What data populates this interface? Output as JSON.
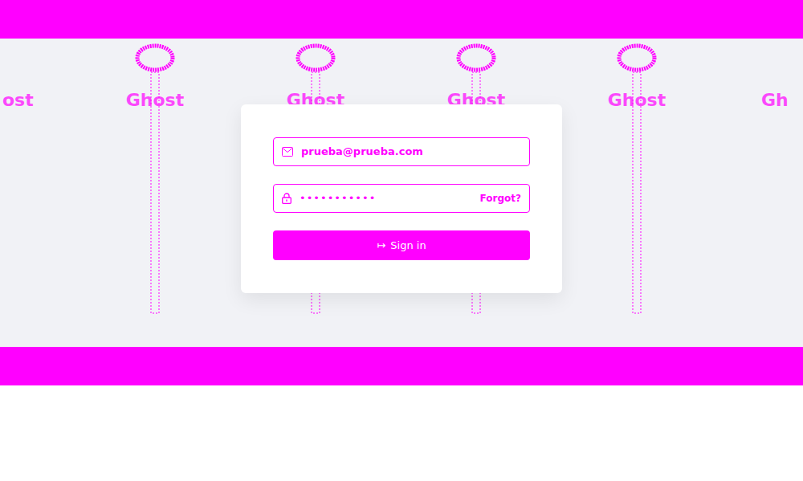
{
  "background": {
    "watermarks": [
      "ost",
      "Ghost",
      "Ghost",
      "Ghost",
      "Ghost",
      "Gh"
    ]
  },
  "login": {
    "email": {
      "value": "prueba@prueba.com"
    },
    "password": {
      "value": "•••••••••••",
      "link": "Forgot?"
    },
    "submit": {
      "icon": "↦",
      "label": "Sign in"
    }
  }
}
